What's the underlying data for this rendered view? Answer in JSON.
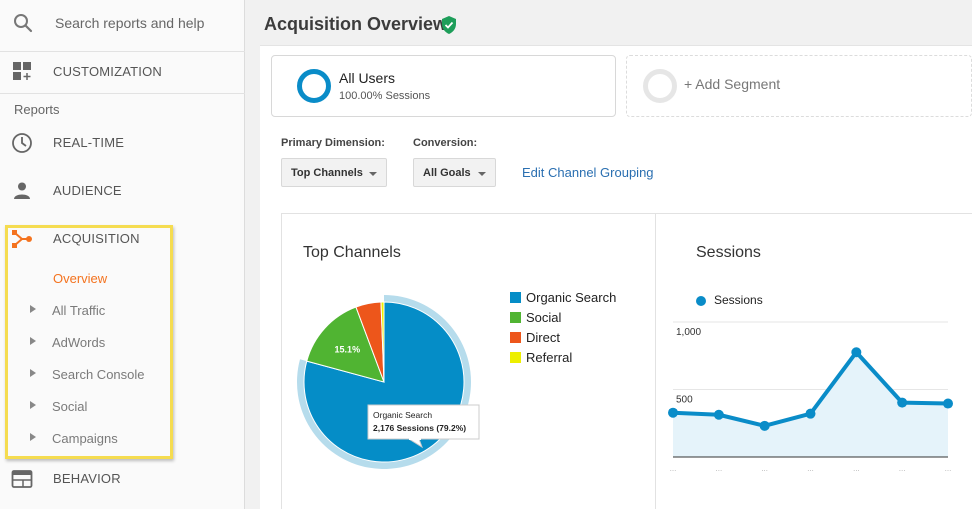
{
  "sidebar": {
    "search_placeholder": "Search reports and help",
    "customization": "CUSTOMIZATION",
    "reports_heading": "Reports",
    "items": [
      {
        "label": "REAL-TIME",
        "icon": "clock-icon"
      },
      {
        "label": "AUDIENCE",
        "icon": "person-icon"
      },
      {
        "label": "ACQUISITION",
        "icon": "acquisition-icon"
      },
      {
        "label": "BEHAVIOR",
        "icon": "behavior-icon"
      }
    ],
    "acquisition_subitems": [
      {
        "label": "Overview",
        "active": true,
        "expandable": false
      },
      {
        "label": "All Traffic",
        "active": false,
        "expandable": true
      },
      {
        "label": "AdWords",
        "active": false,
        "expandable": true
      },
      {
        "label": "Search Console",
        "active": false,
        "expandable": true
      },
      {
        "label": "Social",
        "active": false,
        "expandable": true
      },
      {
        "label": "Campaigns",
        "active": false,
        "expandable": true
      }
    ],
    "highlight_color": "#f5dc50",
    "active_color": "#f4731f"
  },
  "header": {
    "title": "Acquisition Overview",
    "verified_icon": "shield-check-icon"
  },
  "segments": {
    "all_users": {
      "title": "All Users",
      "subtitle": "100.00% Sessions"
    },
    "add_segment": {
      "label": "+ Add Segment"
    }
  },
  "controls": {
    "primary_dimension_label": "Primary Dimension:",
    "primary_dimension_value": "Top Channels",
    "conversion_label": "Conversion:",
    "conversion_value": "All Goals",
    "edit_link": "Edit Channel Grouping"
  },
  "chart_data": [
    {
      "type": "pie",
      "title": "Top Channels",
      "categories": [
        "Organic Search",
        "Social",
        "Direct",
        "Referral"
      ],
      "values": [
        79.2,
        15.1,
        5.1,
        0.6
      ],
      "unit": "% of sessions",
      "colors": [
        "#058dc7",
        "#50b432",
        "#ed561b",
        "#edef00"
      ],
      "slice_labels": [
        "",
        "15.1%",
        "",
        ""
      ],
      "legend": "right",
      "highlighted": "Organic Search",
      "tooltip": {
        "title": "Organic Search",
        "value": "2,176 Sessions (79.2%)"
      }
    },
    {
      "type": "area",
      "title": "Sessions",
      "series": [
        {
          "name": "Sessions",
          "values": [
            328,
            313,
            231,
            321,
            776,
            403,
            396
          ],
          "color": "#0a8cc8"
        }
      ],
      "x": [
        "…",
        "…",
        "…",
        "…",
        "…",
        "…",
        "…"
      ],
      "yticks": [
        500,
        1000
      ],
      "ytick_labels": [
        "500",
        "1,000"
      ],
      "ylim": [
        0,
        1000
      ],
      "grid": true,
      "legend": "top-left"
    }
  ]
}
